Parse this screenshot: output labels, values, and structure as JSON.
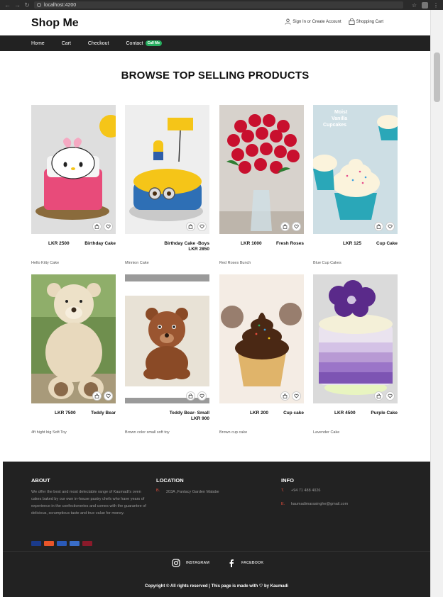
{
  "browser": {
    "url": "localhost:4200"
  },
  "header": {
    "brand": "Shop Me",
    "signin_label": "Sign In or Create Account",
    "cart_label": "Shopping Cart"
  },
  "nav": {
    "items": [
      "Home",
      "Cart",
      "Checkout",
      "Contact"
    ],
    "contact_badge": "Call Me"
  },
  "section": {
    "title": "BROWSE TOP SELLING PRODUCTS"
  },
  "products": [
    {
      "price": "LKR 2500",
      "name": "Birthday Cake",
      "desc": "Hello Kitty Cake",
      "icon": "hello-kitty-cake"
    },
    {
      "price": "LKR 2850",
      "name": "Birthday Cake -Boys",
      "desc": "Minnion Cake",
      "icon": "minion-cake"
    },
    {
      "price": "LKR 1000",
      "name": "Fresh Roses",
      "desc": "Red Roses Bunch",
      "icon": "roses"
    },
    {
      "price": "LKR 125",
      "name": "Cup Cake",
      "desc": "Blue Cup Cakes",
      "icon": "blue-cupcakes"
    },
    {
      "price": "LKR 7500",
      "name": "Teddy Bear",
      "desc": "4ft hight big Soft Toy",
      "icon": "big-teddy"
    },
    {
      "price": "LKR 900",
      "name": "Teddy Bear- Small",
      "desc": "Brown color small soft toy",
      "icon": "small-teddy"
    },
    {
      "price": "LKR 200",
      "name": "Cup cake",
      "desc": "Brown cup cake",
      "icon": "brown-cupcake"
    },
    {
      "price": "LKR 4500",
      "name": "Purple Cake",
      "desc": "Lavender Cake",
      "icon": "purple-cake"
    }
  ],
  "footer": {
    "about_title": "ABOUT",
    "about_text": "We offer the best and most delectable range of Kaumadi's oven cakes baked by our own in-house pastry chefs who have years of experience in the confectioneries and comes with the guarantee of delicious, scrumptious taste and true value for money.",
    "location_title": "LOCATION",
    "location_label": "B.",
    "location_text": "203A ,Fantacy Garden Malabe",
    "info_title": "INFO",
    "phone_label": "T.",
    "phone": "+94 71 488 4026",
    "email_label": "E.",
    "email": "kaumadimarasinghe@gmail.com",
    "payment_icons": [
      "visa-icon",
      "mastercard-icon",
      "maestro-icon",
      "paypal-icon",
      "other-card-icon"
    ]
  },
  "social": {
    "instagram": "INSTAGRAM",
    "facebook": "FACEBOOK"
  },
  "copyright": {
    "text": "Copyright © All rights reserved | This page is made with ♡ by Kaumadi"
  },
  "colors": {
    "dark": "#222222",
    "accent_green": "#27ae60",
    "label_red": "#e74c3c"
  }
}
